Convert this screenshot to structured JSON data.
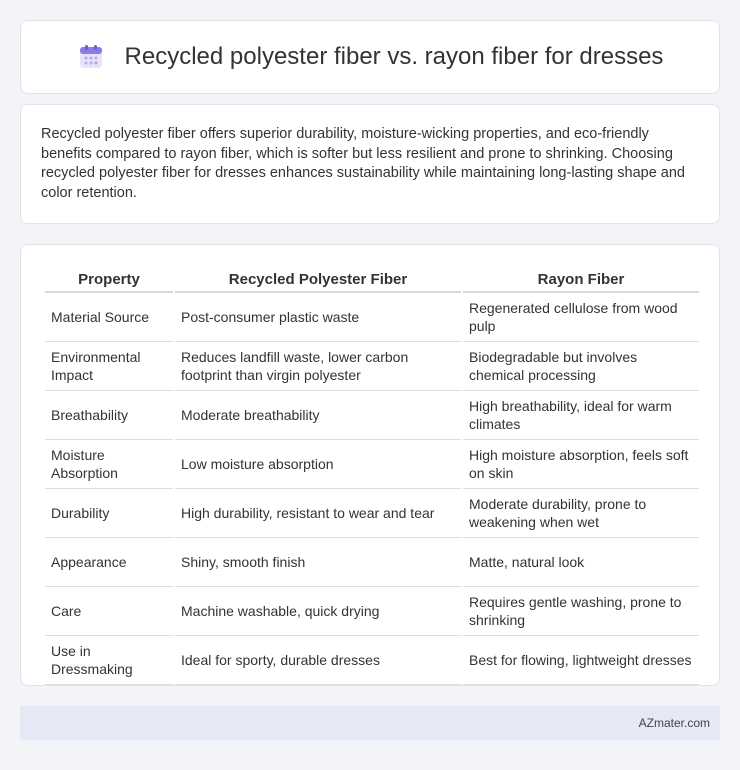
{
  "title": "Recycled polyester fiber vs. rayon fiber for dresses",
  "summary": "Recycled polyester fiber offers superior durability, moisture-wicking properties, and eco-friendly benefits compared to rayon fiber, which is softer but less resilient and prone to shrinking. Choosing recycled polyester fiber for dresses enhances sustainability while maintaining long-lasting shape and color retention.",
  "table": {
    "headers": [
      "Property",
      "Recycled Polyester Fiber",
      "Rayon Fiber"
    ],
    "rows": [
      [
        "Material Source",
        "Post-consumer plastic waste",
        "Regenerated cellulose from wood pulp"
      ],
      [
        "Environmental Impact",
        "Reduces landfill waste, lower carbon footprint than virgin polyester",
        "Biodegradable but involves chemical processing"
      ],
      [
        "Breathability",
        "Moderate breathability",
        "High breathability, ideal for warm climates"
      ],
      [
        "Moisture Absorption",
        "Low moisture absorption",
        "High moisture absorption, feels soft on skin"
      ],
      [
        "Durability",
        "High durability, resistant to wear and tear",
        "Moderate durability, prone to weakening when wet"
      ],
      [
        "Appearance",
        "Shiny, smooth finish",
        "Matte, natural look"
      ],
      [
        "Care",
        "Machine washable, quick drying",
        "Requires gentle washing, prone to shrinking"
      ],
      [
        "Use in Dressmaking",
        "Ideal for sporty, durable dresses",
        "Best for flowing, lightweight dresses"
      ]
    ]
  },
  "footer": "AZmater.com",
  "icon": "calendar-icon",
  "colors": {
    "background": "#f3f4f8",
    "footer_bg": "#e5e9f5",
    "icon_accent": "#8c7be0"
  }
}
